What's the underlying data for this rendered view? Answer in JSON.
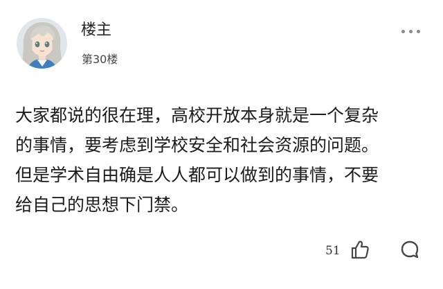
{
  "post": {
    "author": "楼主",
    "floor": "第30楼",
    "content_lines": [
      "大家都说的很在理，高校开放本身就是一个复杂",
      "的事情，要考虑到学校安全和社会资源的问题。",
      "但是学术自由确是人人都可以做到的事情，不要",
      "给自己的思想下门禁。"
    ],
    "likes": "51"
  },
  "icons": {
    "avatar": "anime-girl-avatar",
    "more": "more-dots-icon",
    "like": "thumbs-up-icon",
    "comment": "comment-bubble-icon"
  },
  "colors": {
    "text": "#1b1b1b",
    "muted": "#8a8a8a",
    "icon": "#444444"
  }
}
